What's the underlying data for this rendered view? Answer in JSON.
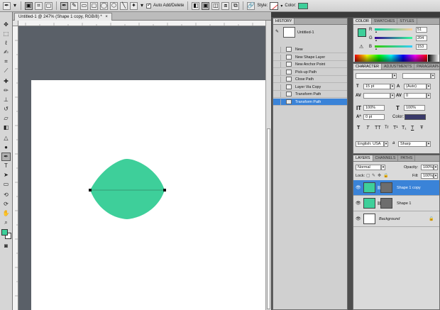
{
  "options_bar": {
    "auto_add_delete_label": "Auto Add/Delete",
    "style_label": "Style:",
    "color_label": "Color:",
    "color_swatch": "#3ecf9a"
  },
  "document": {
    "tab_title": "Untitled-1 @ 247% (Shape 1 copy, RGB/8) *",
    "close_glyph": "×",
    "shape_color": "#3ecf9a",
    "canvas_color": "#ffffff"
  },
  "tools": {
    "foreground_color": "#3ecf9a",
    "background_color": "#ffffff",
    "icons": [
      "move-icon",
      "marquee-icon",
      "lasso-icon",
      "quick-select-icon",
      "crop-icon",
      "eyedropper-icon",
      "healing-brush-icon",
      "brush-icon",
      "clone-stamp-icon",
      "history-brush-icon",
      "eraser-icon",
      "gradient-icon",
      "blur-icon",
      "dodge-icon",
      "pen-icon",
      "type-icon",
      "path-select-icon",
      "shape-icon",
      "3d-rotate-icon",
      "3d-orbit-icon",
      "hand-icon",
      "zoom-icon"
    ]
  },
  "history": {
    "tab_label": "HISTORY",
    "snapshot_label": "Untitled-1",
    "items": [
      {
        "label": "New",
        "selected": false
      },
      {
        "label": "New Shape Layer",
        "selected": false
      },
      {
        "label": "New Anchor Point",
        "selected": false
      },
      {
        "label": "Pick-up Path",
        "selected": false
      },
      {
        "label": "Close Path",
        "selected": false
      },
      {
        "label": "Layer Via Copy",
        "selected": false
      },
      {
        "label": "Transform Path",
        "selected": false
      },
      {
        "label": "Transform Path",
        "selected": true
      }
    ]
  },
  "color_panel": {
    "tabs": [
      "COLOR",
      "SWATCHES",
      "STYLES"
    ],
    "r_label": "R",
    "g_label": "G",
    "b_label": "B",
    "r_value": "51",
    "g_value": "204",
    "b_value": "153",
    "fg_color": "#3ecf9a",
    "bg_color": "#ffffff"
  },
  "character_panel": {
    "tabs": [
      "CHARACTER",
      "ADJUSTMENTS",
      "PARAGRAPH"
    ],
    "font_family": "",
    "font_style": "",
    "font_size": "15 pt",
    "leading": "(Auto)",
    "kerning": "",
    "tracking": "0",
    "vertical_scale": "100%",
    "horizontal_scale": "100%",
    "baseline_shift": "0 pt",
    "color_label": "Color:",
    "text_color": "#3a3a6a",
    "language": "English: USA",
    "antialias_label": "a",
    "antialias": "Sharp",
    "style_buttons": [
      "T",
      "T",
      "TT",
      "Tr",
      "T¹",
      "T₁",
      "T",
      "Ŧ"
    ]
  },
  "layers_panel": {
    "tabs": [
      "LAYERS",
      "CHANNELS",
      "PATHS"
    ],
    "blend_mode": "Normal",
    "opacity_label": "Opacity:",
    "opacity_value": "100%",
    "lock_label": "Lock:",
    "fill_label": "Fill:",
    "fill_value": "100%",
    "layers": [
      {
        "name": "Shape 1 copy",
        "selected": true,
        "thumb_color": "#3ecf9a"
      },
      {
        "name": "Shape 1",
        "selected": false,
        "thumb_color": "#3ecf9a"
      },
      {
        "name": "Background",
        "selected": false,
        "thumb_color": "#ffffff"
      }
    ]
  }
}
